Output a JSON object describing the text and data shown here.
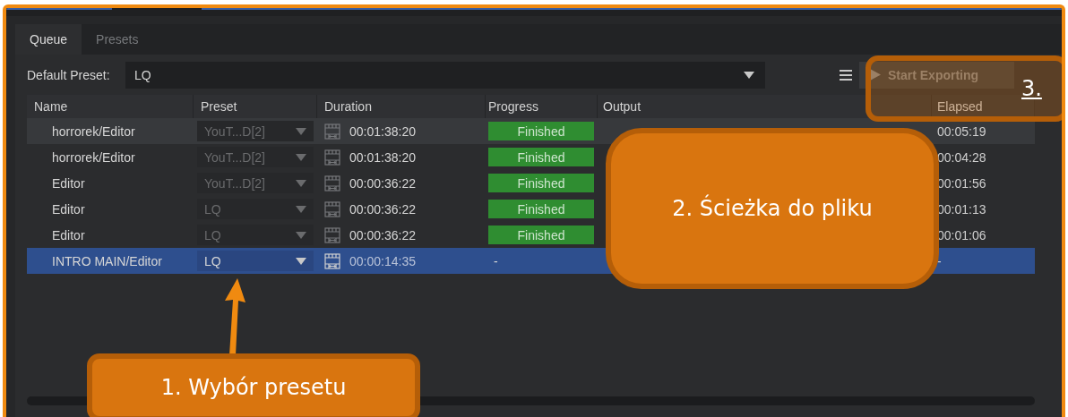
{
  "tabs": [
    {
      "label": "Queue",
      "selected": true
    },
    {
      "label": "Presets",
      "selected": false
    }
  ],
  "default_preset": {
    "label": "Default Preset:",
    "value": "LQ"
  },
  "start_button": {
    "label": "Start Exporting",
    "disabled": true
  },
  "table": {
    "columns": [
      "Name",
      "Preset",
      "Duration",
      "Progress",
      "Output",
      "Elapsed"
    ],
    "rows": [
      {
        "name": "horrorek/Editor",
        "preset": "YouT...D[2]",
        "duration": "00:01:38:20",
        "progress": "Finished",
        "finished": true,
        "elapsed": "00:05:19",
        "selected": false,
        "hovered": true
      },
      {
        "name": "horrorek/Editor",
        "preset": "YouT...D[2]",
        "duration": "00:01:38:20",
        "progress": "Finished",
        "finished": true,
        "elapsed": "00:04:28",
        "selected": false,
        "hovered": false
      },
      {
        "name": "Editor",
        "preset": "YouT...D[2]",
        "duration": "00:00:36:22",
        "progress": "Finished",
        "finished": true,
        "elapsed": "00:01:56",
        "selected": false,
        "hovered": false
      },
      {
        "name": "Editor",
        "preset": "LQ",
        "duration": "00:00:36:22",
        "progress": "Finished",
        "finished": true,
        "elapsed": "00:01:13",
        "selected": false,
        "hovered": false
      },
      {
        "name": "Editor",
        "preset": "LQ",
        "duration": "00:00:36:22",
        "progress": "Finished",
        "finished": true,
        "elapsed": "00:01:06",
        "selected": false,
        "hovered": false
      },
      {
        "name": "INTRO MAIN/Editor",
        "preset": "LQ",
        "duration": "00:00:14:35",
        "progress": "-",
        "finished": false,
        "elapsed": "-",
        "selected": true,
        "hovered": false
      }
    ]
  },
  "callouts": [
    {
      "text": "1. Wybór presetu"
    },
    {
      "text": "2. Ścieżka do pliku"
    },
    {
      "text": "3."
    }
  ]
}
